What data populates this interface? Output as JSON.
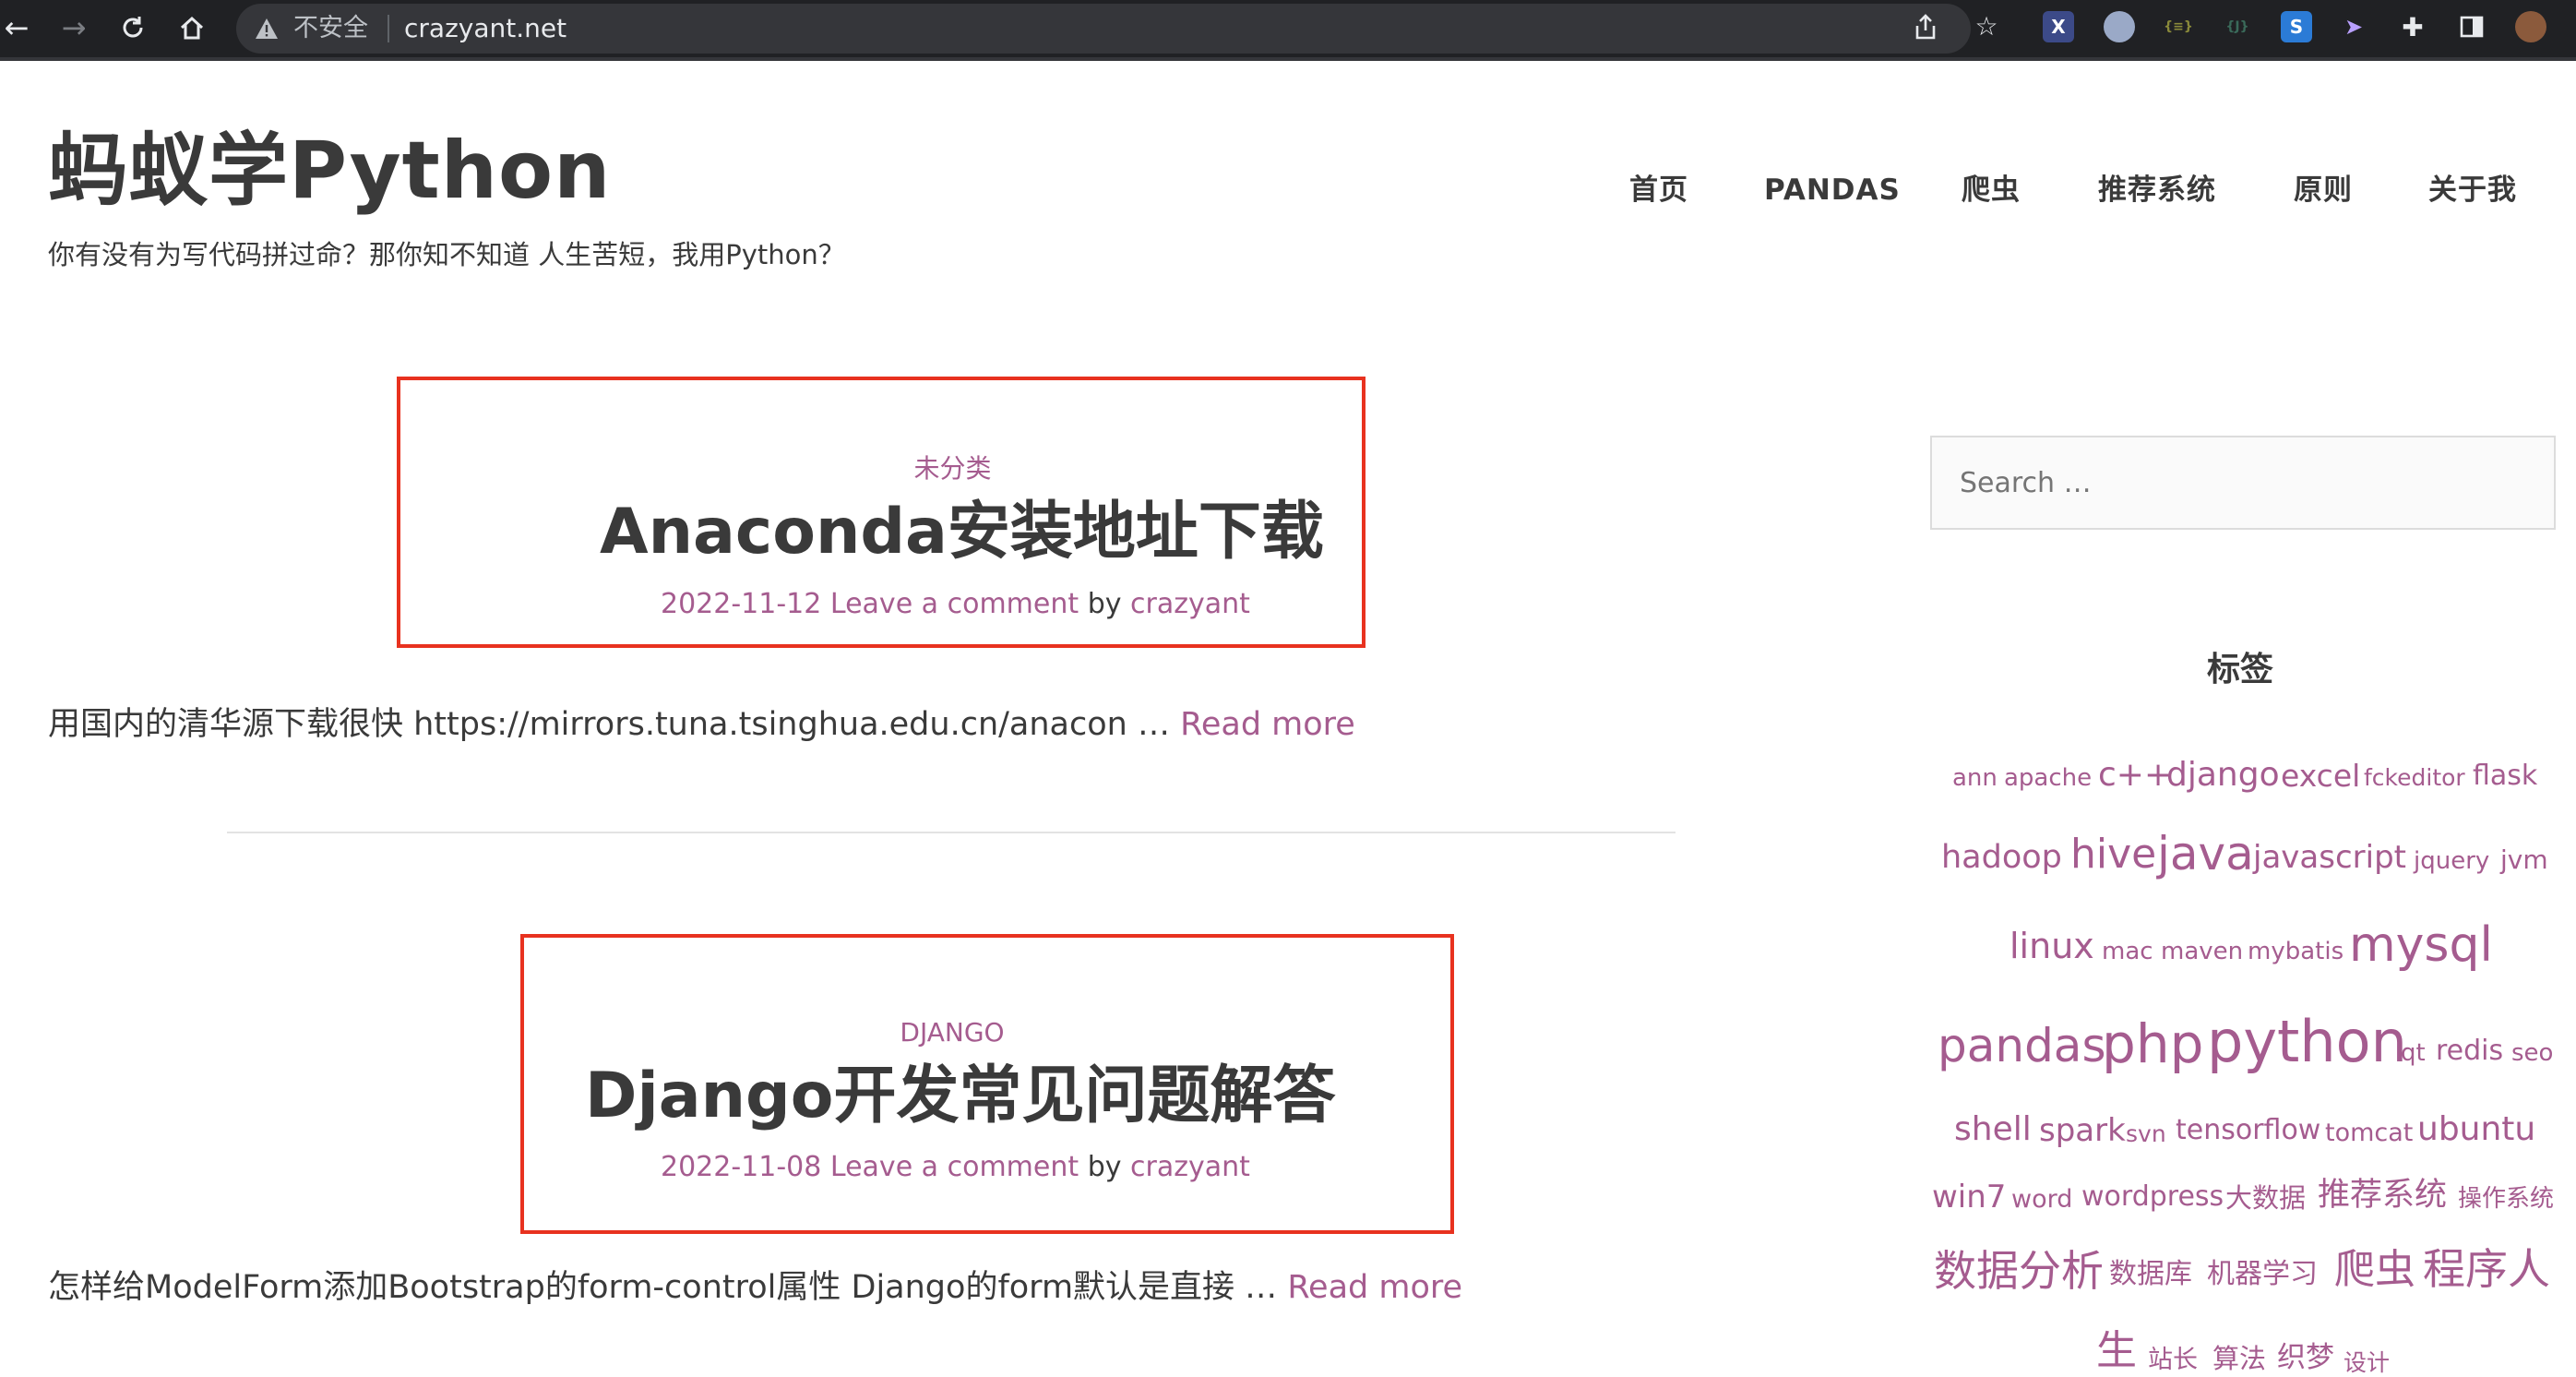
{
  "browser": {
    "security_label": "不安全",
    "url": "crazyant.net"
  },
  "header": {
    "site_title": "蚂蚁学Python",
    "tagline": "你有没有为写代码拼过命？那你知不知道 人生苦短，我用Python？",
    "nav": [
      {
        "label": "首页"
      },
      {
        "label": "PANDAS"
      },
      {
        "label": "爬虫"
      },
      {
        "label": "推荐系统"
      },
      {
        "label": "原则"
      },
      {
        "label": "关于我"
      }
    ]
  },
  "posts": [
    {
      "category": "未分类",
      "title": "Anaconda安装地址下载",
      "date": "2022-11-12",
      "comment_link": "Leave a comment",
      "by": "by",
      "author": "crazyant",
      "excerpt": "用国内的清华源下载很快 https://mirrors.tuna.tsinghua.edu.cn/anacon …",
      "read_more": "Read more"
    },
    {
      "category": "DJANGO",
      "title": "Django开发常见问题解答",
      "date": "2022-11-08",
      "comment_link": "Leave a comment",
      "by": "by",
      "author": "crazyant",
      "excerpt": "怎样给ModelForm添加Bootstrap的form-control属性 Django的form默认是直接 …",
      "read_more": "Read more"
    }
  ],
  "sidebar": {
    "search_placeholder": "Search …",
    "tags_title": "标签",
    "tags": [
      "ann",
      "apache",
      "c++",
      "django",
      "excel",
      "fckeditor",
      "flask",
      "hadoop",
      "hive",
      "java",
      "javascript",
      "jquery",
      "jvm",
      "linux",
      "mac",
      "maven",
      "mybatis",
      "mysql",
      "pandas",
      "php",
      "python",
      "qt",
      "redis",
      "seo",
      "shell",
      "spark",
      "svn",
      "tensorflow",
      "tomcat",
      "ubuntu",
      "win7",
      "word",
      "wordpress",
      "大数据",
      "推荐系统",
      "操作系统",
      "数据分析",
      "数据库",
      "机器学习",
      "爬虫",
      "程序人",
      "生",
      "站长",
      "算法",
      "织梦",
      "设计"
    ]
  },
  "colors": {
    "accent": "#a55c8f",
    "text": "#3a3a3a",
    "highlight_box": "#e8321f",
    "chrome_bg": "#202124"
  }
}
